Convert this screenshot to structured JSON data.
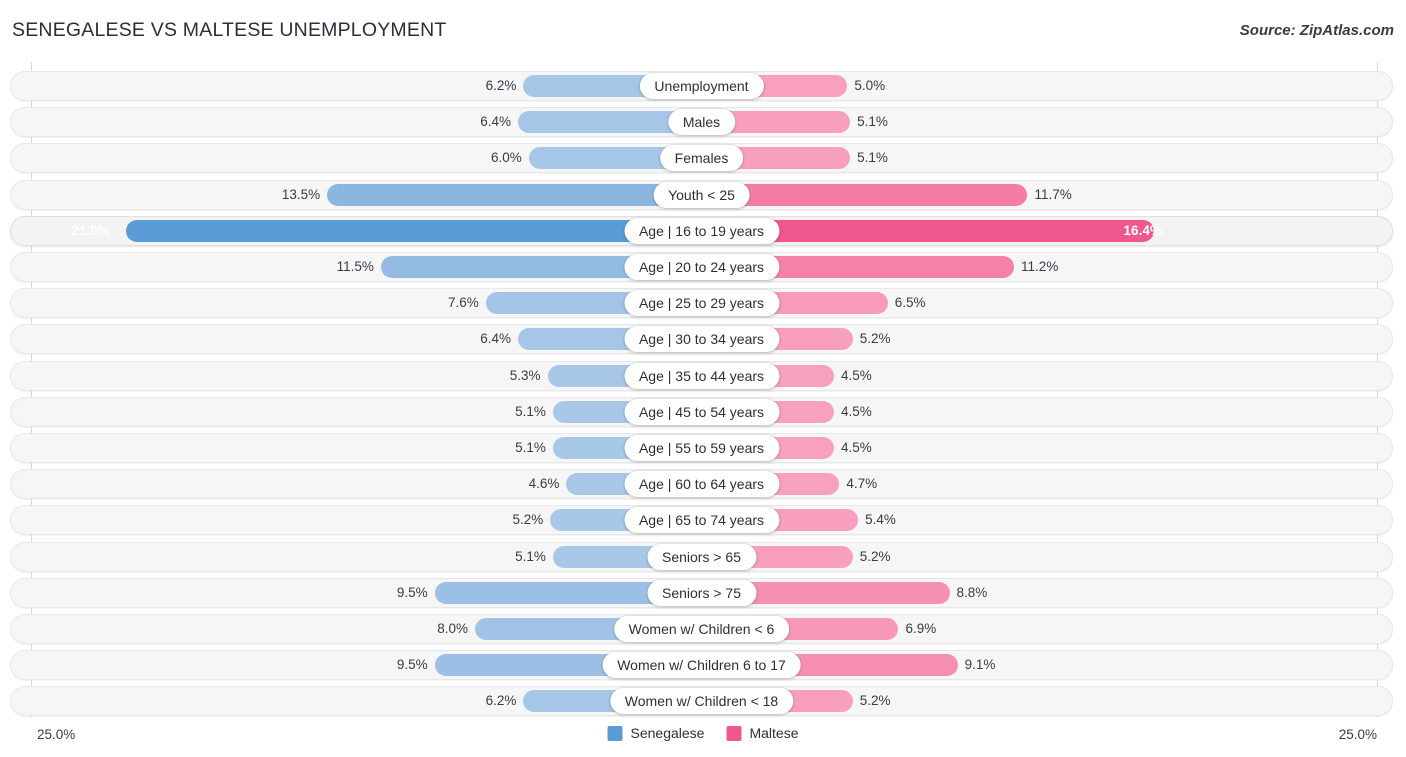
{
  "header": {
    "title": "SENEGALESE VS MALTESE UNEMPLOYMENT",
    "source": "Source: ZipAtlas.com"
  },
  "footer": {
    "axis_left": "25.0%",
    "axis_right": "25.0%",
    "legend": [
      {
        "label": "Senegalese",
        "color": "#5b9bd5"
      },
      {
        "label": "Maltese",
        "color": "#f0578f"
      }
    ]
  },
  "chart_data": {
    "type": "bar",
    "subtype": "diverging-bidirectional",
    "title": "SENEGALESE VS MALTESE UNEMPLOYMENT",
    "xlabel": "",
    "ylabel": "",
    "axis_max": 25.0,
    "axis_left_label": "25.0%",
    "axis_right_label": "25.0%",
    "unit": "%",
    "grid": false,
    "legend_position": "bottom-center",
    "categories": [
      "Unemployment",
      "Males",
      "Females",
      "Youth < 25",
      "Age | 16 to 19 years",
      "Age | 20 to 24 years",
      "Age | 25 to 29 years",
      "Age | 30 to 34 years",
      "Age | 35 to 44 years",
      "Age | 45 to 54 years",
      "Age | 55 to 59 years",
      "Age | 60 to 64 years",
      "Age | 65 to 74 years",
      "Seniors > 65",
      "Seniors > 75",
      "Women w/ Children < 6",
      "Women w/ Children 6 to 17",
      "Women w/ Children < 18"
    ],
    "series": [
      {
        "name": "Senegalese",
        "color": "#5b9bd5",
        "side": "left",
        "values": [
          6.2,
          6.4,
          6.0,
          13.5,
          21.0,
          11.5,
          7.6,
          6.4,
          5.3,
          5.1,
          5.1,
          4.6,
          5.2,
          5.1,
          9.5,
          8.0,
          9.5,
          6.2
        ],
        "labels": [
          "6.2%",
          "6.4%",
          "6.0%",
          "13.5%",
          "21.0%",
          "11.5%",
          "7.6%",
          "6.4%",
          "5.3%",
          "5.1%",
          "5.1%",
          "4.6%",
          "5.2%",
          "5.1%",
          "9.5%",
          "8.0%",
          "9.5%",
          "6.2%"
        ]
      },
      {
        "name": "Maltese",
        "color": "#f0578f",
        "side": "right",
        "values": [
          5.0,
          5.1,
          5.1,
          11.7,
          16.4,
          11.2,
          6.5,
          5.2,
          4.5,
          4.5,
          4.5,
          4.7,
          5.4,
          5.2,
          8.8,
          6.9,
          9.1,
          5.2
        ],
        "labels": [
          "5.0%",
          "5.1%",
          "5.1%",
          "11.7%",
          "16.4%",
          "11.2%",
          "6.5%",
          "5.2%",
          "4.5%",
          "4.5%",
          "4.5%",
          "4.7%",
          "5.4%",
          "5.2%",
          "8.8%",
          "6.9%",
          "9.1%",
          "5.2%"
        ]
      }
    ],
    "highlight_row_index": 4
  }
}
